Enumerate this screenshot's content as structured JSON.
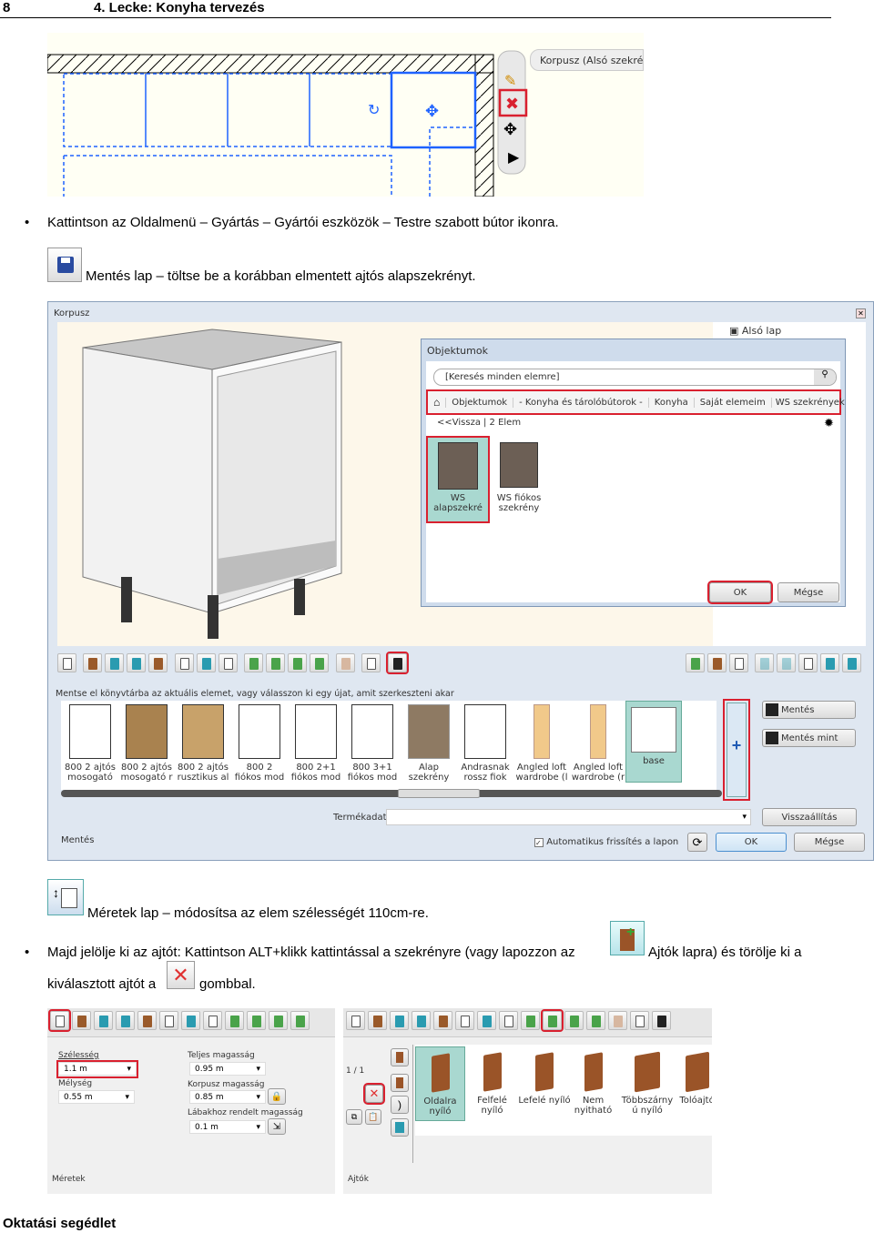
{
  "header": {
    "page_number": "8",
    "title": "4. Lecke: Konyha tervezés"
  },
  "figure1": {
    "label": "Korpusz (Alsó szekrény)"
  },
  "bullet1": "Kattintson az Oldalmenü – Gyártás – Gyártói eszközök – Testre szabott bútor ikonra.",
  "step_save": "Mentés lap – töltse be a korábban elmentett ajtós alapszekrényt.",
  "dialog": {
    "title": "Korpusz",
    "also_lap": "Alsó lap",
    "objektumok": {
      "title": "Objektumok",
      "search_placeholder": "[Keresés minden elemre]",
      "breadcrumb": [
        "Objektumok",
        "- Konyha és tárolóbútorok -",
        "Konyha",
        "Saját elemeim",
        "WS szekrények"
      ],
      "back": "<<Vissza",
      "count": "| 2 Elem",
      "items": [
        {
          "l1": "WS",
          "l2": "alapszekré"
        },
        {
          "l1": "WS fiókos",
          "l2": "szekrény"
        }
      ],
      "ok": "OK",
      "cancel": "Mégse"
    },
    "hint": "Mentse el könyvtárba az aktuális elemet, vagy válasszon ki egy újat, amit szerkeszteni akar",
    "library": [
      {
        "l1": "800 2 ajtós",
        "l2": "mosogató"
      },
      {
        "l1": "800 2 ajtós",
        "l2": "mosogató r"
      },
      {
        "l1": "800 2 ajtós",
        "l2": "rusztikus al"
      },
      {
        "l1": "800 2",
        "l2": "fiókos mod"
      },
      {
        "l1": "800 2+1",
        "l2": "fiókos mod"
      },
      {
        "l1": "800 3+1",
        "l2": "fiókos mod"
      },
      {
        "l1": "Alap",
        "l2": "szekrény"
      },
      {
        "l1": "Andrasnak",
        "l2": "rossz fiok"
      },
      {
        "l1": "Angled loft",
        "l2": "wardrobe (l"
      },
      {
        "l1": "Angled loft",
        "l2": "wardrobe (r"
      },
      {
        "l1": "base",
        "l2": ""
      }
    ],
    "save": "Mentés",
    "save_as": "Mentés mint",
    "termekadat_label": "Termékadat",
    "reset": "Visszaállítás",
    "tab_label": "Mentés",
    "auto_refresh": "Automatikus frissítés a lapon",
    "ok": "OK",
    "cancel": "Mégse"
  },
  "step_meretek": "Méretek lap – módosítsa az elem szélességét 110cm-re.",
  "bullet2": {
    "part1": "Majd jelölje ki az ajtót: Kattintson ALT+klikk kattintással a szekrényre (vagy lapozzon az",
    "part2": "Ajtók lapra) és törölje ki a",
    "part3": "kiválasztott ajtót a",
    "part4": "gombbal."
  },
  "meretek_panel": {
    "width_label": "Szélesség",
    "width": "1.1 m",
    "depth_label": "Mélység",
    "depth": "0.55 m",
    "total_h_label": "Teljes magasság",
    "total_h": "0.95 m",
    "korpusz_h_label": "Korpusz magasság",
    "korpusz_h": "0.85 m",
    "leg_h_label": "Lábakhoz rendelt magasság",
    "leg_h": "0.1 m",
    "tab": "Méretek"
  },
  "ajtok_panel": {
    "page": "1 / 1",
    "types": [
      {
        "l1": "Oldalra",
        "l2": "nyíló"
      },
      {
        "l1": "Felfelé",
        "l2": "nyíló"
      },
      {
        "l1": "Lefelé nyíló",
        "l2": ""
      },
      {
        "l1": "Nem",
        "l2": "nyitható"
      },
      {
        "l1": "Többszárny",
        "l2": "ú nyíló"
      },
      {
        "l1": "Tolóajtó",
        "l2": ""
      }
    ],
    "tab": "Ajtók"
  },
  "footer": "Oktatási segédlet",
  "colors": {
    "highlight": "#d9202f",
    "selection": "#a9d8d0",
    "plan_blue": "#1e90ff"
  }
}
